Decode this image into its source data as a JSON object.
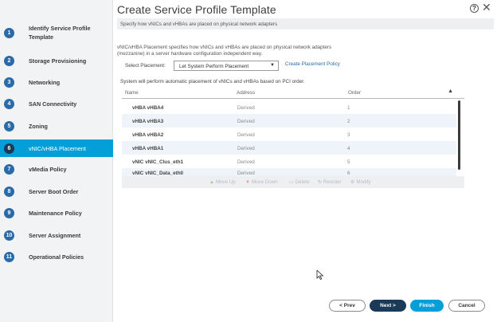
{
  "window": {
    "title": "Create Service Profile Template"
  },
  "subheader": "Specify how vNICs and vHBAs are placed on physical network adapters",
  "steps": [
    {
      "num": "1",
      "label": "Identify Service Profile Template"
    },
    {
      "num": "2",
      "label": "Storage Provisioning"
    },
    {
      "num": "3",
      "label": "Networking"
    },
    {
      "num": "4",
      "label": "SAN Connectivity"
    },
    {
      "num": "5",
      "label": "Zoning"
    },
    {
      "num": "6",
      "label": "vNIC/vHBA Placement",
      "active": true
    },
    {
      "num": "7",
      "label": "vMedia Policy"
    },
    {
      "num": "8",
      "label": "Server Boot Order"
    },
    {
      "num": "9",
      "label": "Maintenance Policy"
    },
    {
      "num": "10",
      "label": "Server Assignment"
    },
    {
      "num": "11",
      "label": "Operational Policies"
    }
  ],
  "description": "vNIC/vHBA Placement specifies how vNICs and vHBAs are placed on physical network adapters (mezzanine) in a server hardware configuration independent way.",
  "placement": {
    "label": "Select Placement:",
    "value": "Let System Perform Placement",
    "create_link": "Create Placement Policy"
  },
  "auto_note": "System will perform automatic placement of vNICs and vHBAs based on PCI order.",
  "table": {
    "columns": [
      "Name",
      "Address",
      "Order"
    ],
    "rows": [
      {
        "name": "vHBA vHBA4",
        "address": "Derived",
        "order": "1"
      },
      {
        "name": "vHBA vHBA3",
        "address": "Derived",
        "order": "2"
      },
      {
        "name": "vHBA vHBA2",
        "address": "Derived",
        "order": "3"
      },
      {
        "name": "vHBA vHBA1",
        "address": "Derived",
        "order": "4"
      },
      {
        "name": "vNIC vNIC_Clus_eth1",
        "address": "Derived",
        "order": "5"
      },
      {
        "name": "vNIC vNIC_Data_eth0",
        "address": "Derived",
        "order": "6"
      }
    ]
  },
  "actions": {
    "move_up": "Move Up",
    "move_down": "Move Down",
    "delete": "Delete",
    "reorder": "Reorder",
    "modify": "Modify"
  },
  "footer": {
    "prev": "< Prev",
    "next": "Next >",
    "finish": "Finish",
    "cancel": "Cancel"
  },
  "icons": {
    "help": "?",
    "close": "✕",
    "caret": "▼",
    "sort": "▲"
  },
  "colors": {
    "accent": "#049fd9",
    "step_circle": "#2a6aa8",
    "next_button": "#1b3a57"
  }
}
